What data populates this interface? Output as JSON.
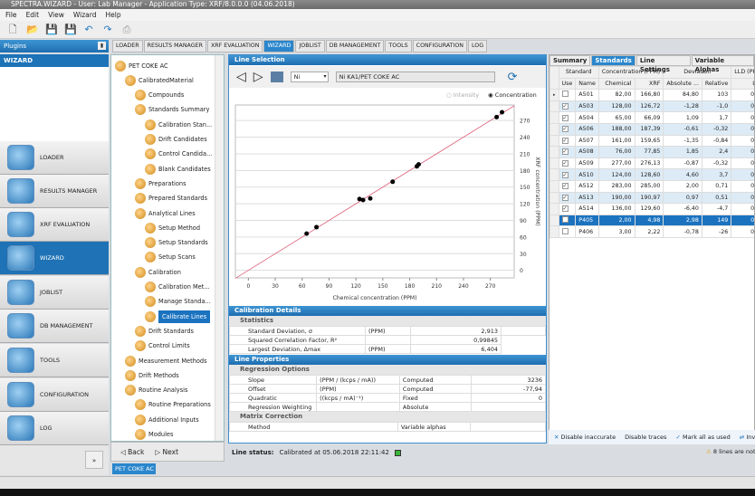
{
  "window": {
    "title": "SPECTRA.WIZARD - User: Lab Manager - Application Type: XRF/8.0.0.0 (04.06.2018)"
  },
  "menu": [
    "File",
    "Edit",
    "View",
    "Wizard",
    "Help"
  ],
  "toolbar_icons": [
    "new-icon",
    "open-icon",
    "save-icon",
    "save-all-icon",
    "undo-icon",
    "redo-icon",
    "print-icon"
  ],
  "plugins": {
    "header": "Plugins",
    "current": "WIZARD",
    "items": [
      "LOADER",
      "RESULTS MANAGER",
      "XRF EVALUATION",
      "WIZARD",
      "JOBLIST",
      "DB MANAGEMENT",
      "TOOLS",
      "CONFIGURATION",
      "LOG"
    ],
    "active": "WIZARD"
  },
  "tabs": [
    "LOADER",
    "RESULTS MANAGER",
    "XRF EVALUATION",
    "WIZARD",
    "JOBLIST",
    "DB MANAGEMENT",
    "TOOLS",
    "CONFIGURATION",
    "LOG"
  ],
  "tree": {
    "items": [
      {
        "label": "PET COKE AC",
        "level": 0
      },
      {
        "label": "CalibratedMaterial",
        "level": 1
      },
      {
        "label": "Compounds",
        "level": 2
      },
      {
        "label": "Standards Summary",
        "level": 2
      },
      {
        "label": "Calibration Stan...",
        "level": 3
      },
      {
        "label": "Drift Candidates",
        "level": 3
      },
      {
        "label": "Control Candida...",
        "level": 3
      },
      {
        "label": "Blank Candidates",
        "level": 3
      },
      {
        "label": "Preparations",
        "level": 2
      },
      {
        "label": "Prepared Standards",
        "level": 2
      },
      {
        "label": "Analytical Lines",
        "level": 2
      },
      {
        "label": "Setup Method",
        "level": 3
      },
      {
        "label": "Setup Standards",
        "level": 3
      },
      {
        "label": "Setup Scans",
        "level": 3
      },
      {
        "label": "Calibration",
        "level": 2
      },
      {
        "label": "Calibration Met...",
        "level": 3
      },
      {
        "label": "Manage Standa...",
        "level": 3
      },
      {
        "label": "Calibrate Lines",
        "level": 3,
        "selected": true
      },
      {
        "label": "Drift Standards",
        "level": 2
      },
      {
        "label": "Control Limits",
        "level": 2
      },
      {
        "label": "Measurement Methods",
        "level": 1
      },
      {
        "label": "Drift Methods",
        "level": 1
      },
      {
        "label": "Routine Analysis",
        "level": 1
      },
      {
        "label": "Routine Preparations",
        "level": 2
      },
      {
        "label": "Additional Inputs",
        "level": 2
      },
      {
        "label": "Modules",
        "level": 2
      }
    ],
    "back": "Back",
    "next": "Next",
    "doc_tab": "PET COKE AC"
  },
  "line_selection": {
    "header": "Line Selection",
    "element": "Ni",
    "line": "Ni KA1/PET COKE AC",
    "radio_intensity": "Intensity",
    "radio_concentration": "Concentration",
    "selected_mode": "Concentration"
  },
  "chart_data": {
    "type": "scatter",
    "xlabel": "Chemical concentration (PPM)",
    "ylabel": "XRF concentration (PPM)",
    "xlim": [
      -14.5,
      296.6
    ],
    "ylim": [
      -13.6,
      298
    ],
    "xticks": [
      0,
      30,
      60,
      90,
      120,
      150,
      180,
      210,
      240,
      270
    ],
    "yticks": [
      0,
      30,
      60,
      90,
      120,
      150,
      180,
      210,
      240,
      270
    ],
    "grid": "horizontal",
    "points": [
      [
        128,
        126.72
      ],
      [
        65,
        66.09
      ],
      [
        188,
        187.39
      ],
      [
        161,
        159.65
      ],
      [
        76,
        77.85
      ],
      [
        277,
        276.13
      ],
      [
        124,
        128.6
      ],
      [
        283,
        285
      ],
      [
        190,
        190.97
      ],
      [
        136,
        129.6
      ]
    ],
    "fit_line": {
      "slope": 1,
      "intercept": 0,
      "color": "#e0607a"
    },
    "point_color": "#000000"
  },
  "calibration_details": {
    "header": "Calibration Details",
    "section": "Statistics",
    "rows": [
      {
        "label": "Standard Deviation, σ",
        "unit": "(PPM)",
        "value": "2,913"
      },
      {
        "label": "Squared Correlation Factor, R²",
        "unit": "",
        "value": "0,99845"
      },
      {
        "label": "Largest Deviation, Δmax",
        "unit": "(PPM)",
        "value": "6,404"
      }
    ]
  },
  "line_properties": {
    "header": "Line Properties",
    "regression_section": "Regression Options",
    "rows": [
      {
        "label": "Slope",
        "unit": "(PPM / (kcps / mA))",
        "mode": "Computed",
        "value": "3236"
      },
      {
        "label": "Offset",
        "unit": "(PPM)",
        "mode": "Computed",
        "value": "-77,94"
      },
      {
        "label": "Quadratic",
        "unit": "((kcps / mA)⁻¹)",
        "mode": "Fixed",
        "value": "0"
      },
      {
        "label": "Regression Weighting",
        "unit": "",
        "mode": "Absolute",
        "value": ""
      }
    ],
    "matrix_section": "Matrix Correction",
    "matrix_rows": [
      {
        "label": "Method",
        "unit": "",
        "mode": "Variable alphas",
        "value": ""
      }
    ]
  },
  "line_status": {
    "label": "Line status:",
    "text": "Calibrated at 05.06.2018 22:11:42",
    "indicator_color": "#3cb43c"
  },
  "right_tabs": [
    "Summary",
    "Standards",
    "Line Settings",
    "Variable Alphas"
  ],
  "right_active_tab": "Standards",
  "standards_table": {
    "group_headers": [
      "Standard",
      "Concentration (PPM)",
      "Deviation",
      "LLD (PPM)"
    ],
    "columns": [
      "Use",
      "Name",
      "Chemical",
      "XRF",
      "Absolute ...",
      "Relative",
      "LLD"
    ],
    "rows": [
      {
        "use": false,
        "name": "A501",
        "chem": "82,00",
        "xrf": "166,80",
        "abs": "84,80",
        "rel": "103",
        "lld": "0,75",
        "current": true
      },
      {
        "use": true,
        "name": "A503",
        "chem": "128,00",
        "xrf": "126,72",
        "abs": "-1,28",
        "rel": "-1,0",
        "lld": "0,35"
      },
      {
        "use": true,
        "name": "A504",
        "chem": "65,00",
        "xrf": "66,09",
        "abs": "1,09",
        "rel": "1,7",
        "lld": "0,35"
      },
      {
        "use": true,
        "name": "A506",
        "chem": "188,00",
        "xrf": "187,39",
        "abs": "-0,61",
        "rel": "-0,32",
        "lld": "0,36"
      },
      {
        "use": true,
        "name": "A507",
        "chem": "161,00",
        "xrf": "159,65",
        "abs": "-1,35",
        "rel": "-0,84",
        "lld": "0,37"
      },
      {
        "use": true,
        "name": "A508",
        "chem": "76,00",
        "xrf": "77,85",
        "abs": "1,85",
        "rel": "2,4",
        "lld": "0,37"
      },
      {
        "use": true,
        "name": "A509",
        "chem": "277,00",
        "xrf": "276,13",
        "abs": "-0,87",
        "rel": "-0,32",
        "lld": "0,38"
      },
      {
        "use": true,
        "name": "A510",
        "chem": "124,00",
        "xrf": "128,60",
        "abs": "4,60",
        "rel": "3,7",
        "lld": "0,39"
      },
      {
        "use": true,
        "name": "A512",
        "chem": "283,00",
        "xrf": "285,00",
        "abs": "2,00",
        "rel": "0,71",
        "lld": "0,42"
      },
      {
        "use": true,
        "name": "A513",
        "chem": "190,00",
        "xrf": "190,97",
        "abs": "0,97",
        "rel": "0,51",
        "lld": "0,42"
      },
      {
        "use": true,
        "name": "A514",
        "chem": "136,00",
        "xrf": "129,60",
        "abs": "-6,40",
        "rel": "-4,7",
        "lld": "0,41"
      },
      {
        "use": false,
        "name": "P405",
        "chem": "2,00",
        "xrf": "4,98",
        "abs": "2,98",
        "rel": "149",
        "lld": "0,32",
        "selected": true
      },
      {
        "use": false,
        "name": "P406",
        "chem": "3,00",
        "xrf": "2,22",
        "abs": "-0,78",
        "rel": "-26",
        "lld": "0,33"
      }
    ]
  },
  "right_buttons": {
    "disable_inaccurate": "Disable inaccurate",
    "disable_traces": "Disable traces",
    "mark_all": "Mark all as used",
    "invert": "Inve"
  },
  "warning": "8 lines are not ca"
}
